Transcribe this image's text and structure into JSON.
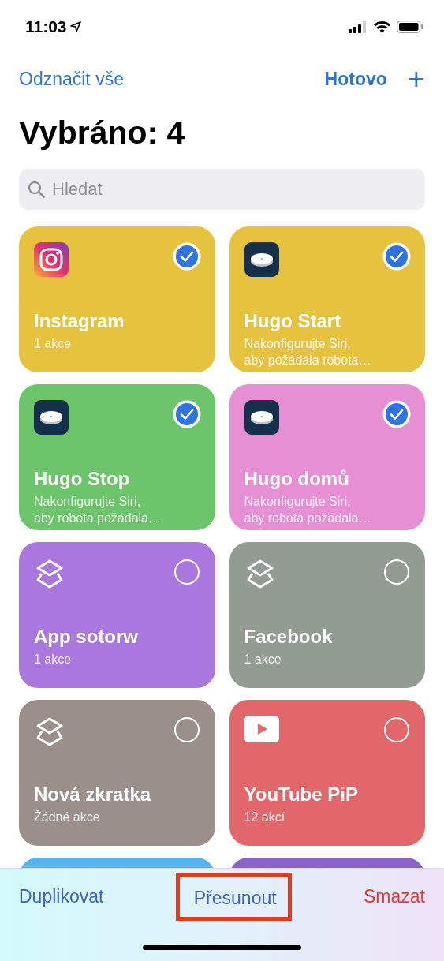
{
  "status_bar": {
    "time": "11:03"
  },
  "nav": {
    "left": "Odznačit vše",
    "done": "Hotovo",
    "add": "+"
  },
  "title": "Vybráno: 4",
  "search": {
    "placeholder": "Hledat"
  },
  "shortcuts": [
    {
      "title": "Instagram",
      "subtitle": "1 akce",
      "color": "#e6c33f",
      "kind": "instagram",
      "selected": true
    },
    {
      "title": "Hugo Start",
      "subtitle": "Nakonfigurujte Siri, aby požádala robota…",
      "color": "#e6c33f",
      "kind": "robot",
      "selected": true
    },
    {
      "title": "Hugo Stop",
      "subtitle": "Nakonfigurujte Siri, aby robota požádala…",
      "color": "#6cc56a",
      "kind": "robot",
      "selected": true
    },
    {
      "title": "Hugo domů",
      "subtitle": "Nakonfigurujte Siri, aby robota požádala…",
      "color": "#e68fd3",
      "kind": "robot",
      "selected": true
    },
    {
      "title": "App sotorw",
      "subtitle": "1 akce",
      "color": "#a878de",
      "kind": "layers",
      "selected": false
    },
    {
      "title": "Facebook",
      "subtitle": "1 akce",
      "color": "#939c93",
      "kind": "layers",
      "selected": false
    },
    {
      "title": "Nová zkratka",
      "subtitle": "Žádné akce",
      "color": "#9b8f8c",
      "kind": "layers",
      "selected": false
    },
    {
      "title": "YouTube PiP",
      "subtitle": "12 akcí",
      "color": "#e2676a",
      "kind": "play",
      "selected": false
    }
  ],
  "peek_cards": [
    {
      "color": "#55b3ee"
    },
    {
      "color": "#8a62c8"
    }
  ],
  "toolbar": [
    {
      "label": "Duplikovat",
      "kind": "normal",
      "highlighted": false
    },
    {
      "label": "Přesunout",
      "kind": "normal",
      "highlighted": true
    },
    {
      "label": "Smazat",
      "kind": "destructive",
      "highlighted": false
    }
  ]
}
